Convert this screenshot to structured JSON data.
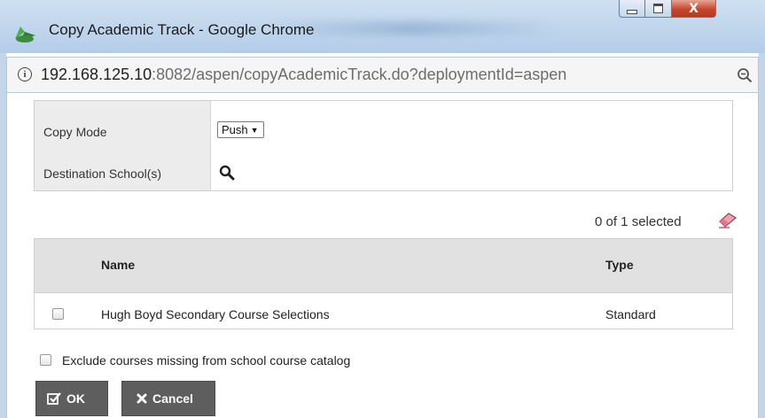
{
  "window": {
    "title": "Copy Academic Track - Google Chrome",
    "close_glyph": "X"
  },
  "address": {
    "url_host": "192.168.125.10",
    "url_rest": ":8082/aspen/copyAcademicTrack.do?deploymentId=aspen",
    "info_glyph": "i"
  },
  "form": {
    "copy_mode_label": "Copy Mode",
    "copy_mode_value": "Push",
    "destination_label": "Destination School(s)"
  },
  "selection": {
    "count_text": "0 of 1 selected"
  },
  "table": {
    "columns": [
      "Name",
      "Type"
    ],
    "rows": [
      {
        "name": "Hugh Boyd Secondary Course Selections",
        "type": "Standard",
        "checked": false
      }
    ]
  },
  "options": {
    "exclude_label": "Exclude courses missing from school course catalog"
  },
  "buttons": {
    "ok_label": "OK",
    "cancel_label": "Cancel"
  },
  "icons": {
    "app": "chrome-app-icon",
    "info": "info-icon",
    "zoom": "zoom-icon",
    "search": "search-icon",
    "eraser": "eraser-icon",
    "ok": "checkbox-icon",
    "cancel": "x-icon"
  },
  "colors": {
    "titlebar": "#b4cde8",
    "close_button": "#c7462c",
    "header_row": "#e1e1e1",
    "button_bg": "#5e5e5e",
    "eraser": "#e8758a"
  }
}
